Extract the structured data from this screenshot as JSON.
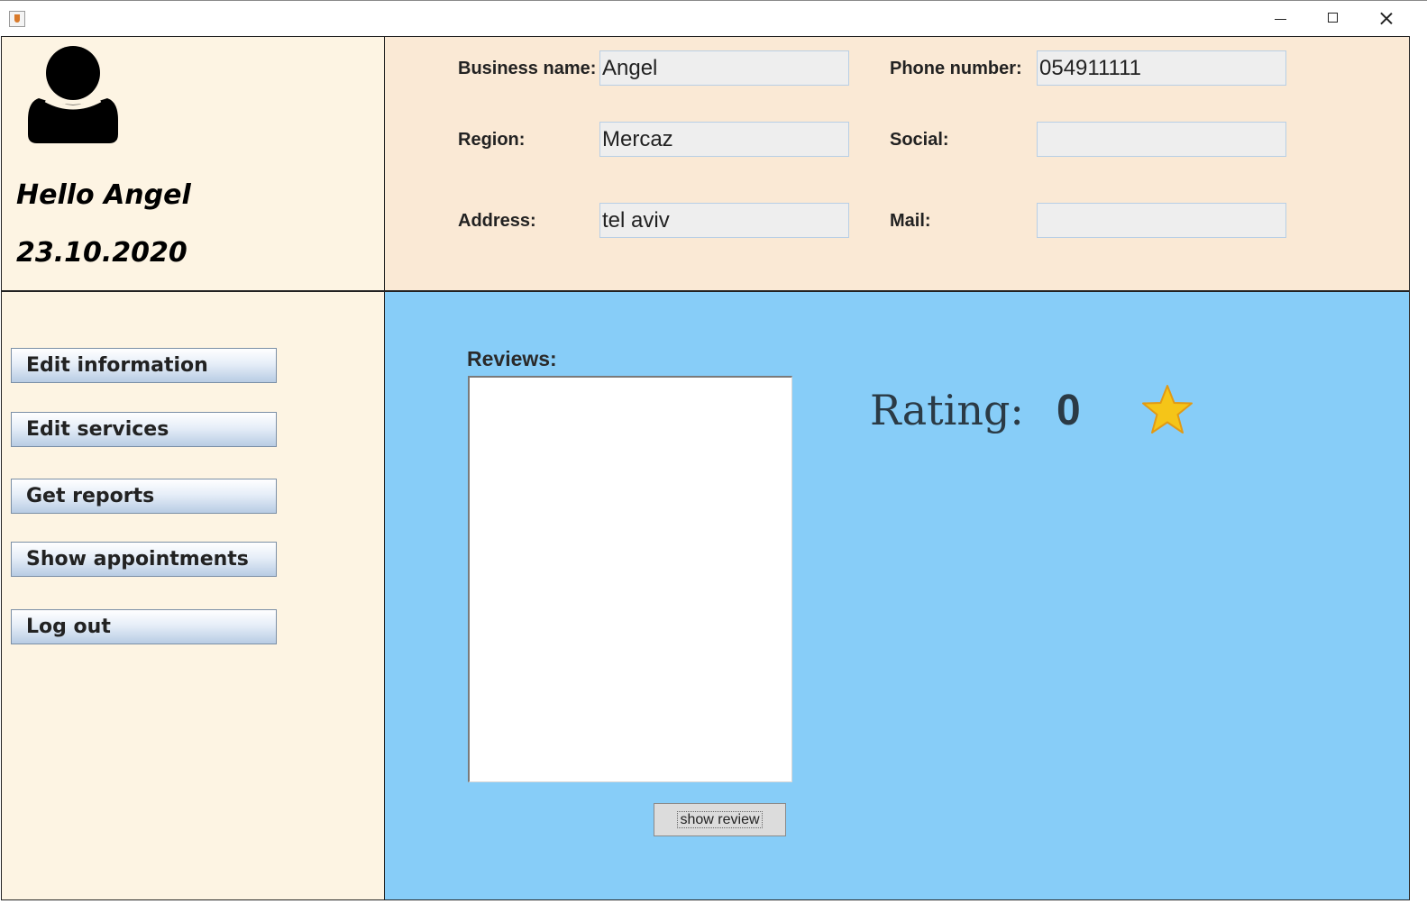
{
  "window": {
    "controls": {
      "minimize": "minimize-icon",
      "maximize": "maximize-icon",
      "close": "close-icon"
    }
  },
  "profile": {
    "greeting": "Hello Angel",
    "date": "23.10.2020",
    "avatar_icon": "user-icon"
  },
  "info": {
    "business_name": {
      "label": "Business name:",
      "value": "Angel"
    },
    "phone_number": {
      "label": "Phone number:",
      "value": "054911111"
    },
    "region": {
      "label": "Region:",
      "value": "Mercaz"
    },
    "social": {
      "label": "Social:",
      "value": ""
    },
    "address": {
      "label": "Address:",
      "value": "tel aviv"
    },
    "mail": {
      "label": "Mail:",
      "value": ""
    }
  },
  "menu": {
    "items": [
      {
        "label": "Edit information"
      },
      {
        "label": "Edit services"
      },
      {
        "label": "Get reports"
      },
      {
        "label": "Show appointments"
      },
      {
        "label": "Log out"
      }
    ]
  },
  "main": {
    "reviews_label": "Reviews:",
    "reviews_text": "",
    "rating_label": "Rating:",
    "rating_value": "0",
    "rating_icon": "star-icon",
    "show_review_label": "show review"
  },
  "colors": {
    "profile_bg": "#fdf4e3",
    "info_bg": "#fae9d5",
    "main_bg": "#87cdf8",
    "star": "#f5c518"
  }
}
